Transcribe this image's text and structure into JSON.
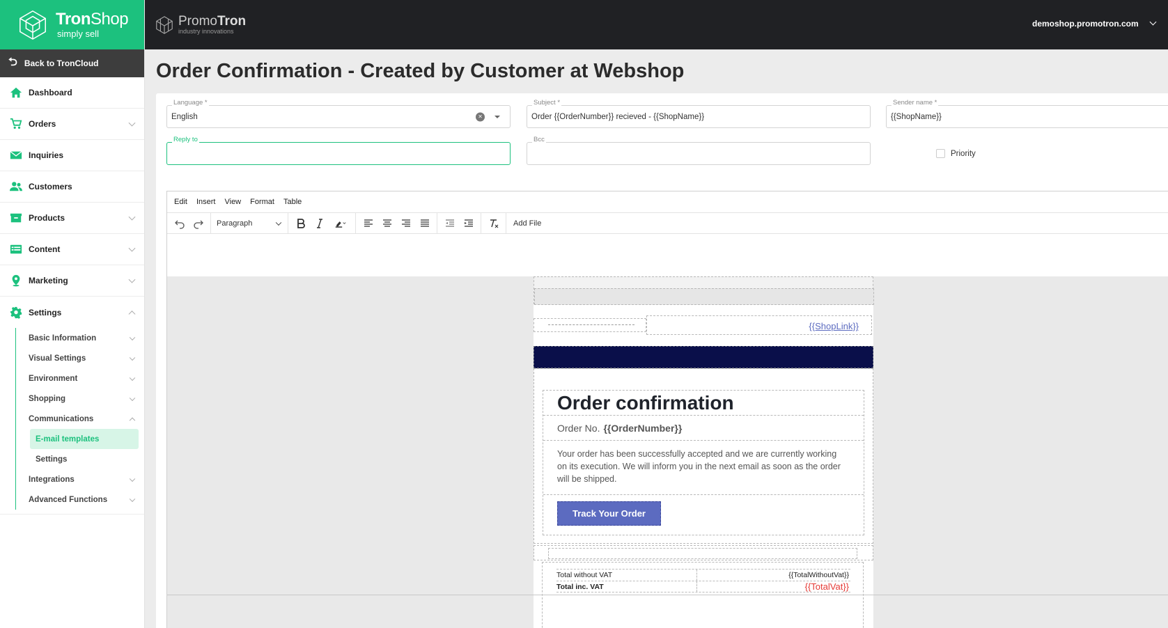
{
  "brand": {
    "name_bold": "Tron",
    "name_light": "Shop",
    "tagline": "simply sell",
    "logo_color": "#1cc17e"
  },
  "topbar": {
    "brand_light": "Promo",
    "brand_bold": "Tron",
    "brand_tagline": "industry innovations",
    "domain": "demoshop.promotron.com"
  },
  "sidebar": {
    "back": "Back to TronCloud",
    "items": [
      {
        "label": "Dashboard",
        "icon": "home-icon"
      },
      {
        "label": "Orders",
        "icon": "cart-icon"
      },
      {
        "label": "Inquiries",
        "icon": "envelope-icon"
      },
      {
        "label": "Customers",
        "icon": "users-icon"
      },
      {
        "label": "Products",
        "icon": "box-icon"
      },
      {
        "label": "Content",
        "icon": "list-icon"
      },
      {
        "label": "Marketing",
        "icon": "map-pin-icon"
      },
      {
        "label": "Settings",
        "icon": "gear-icon"
      }
    ],
    "settings_sub": [
      "Basic Information",
      "Visual Settings",
      "Environment",
      "Shopping",
      "Communications",
      "Integrations",
      "Advanced Functions"
    ],
    "communications_sub": [
      "E-mail templates",
      "Settings"
    ]
  },
  "page": {
    "title": "Order Confirmation - Created by Customer at Webshop"
  },
  "form": {
    "language": {
      "label": "Language *",
      "value": "English"
    },
    "subject": {
      "label": "Subject *",
      "value": "Order {{OrderNumber}} recieved - {{ShopName}}"
    },
    "sender": {
      "label": "Sender name *",
      "value": "{{ShopName}}"
    },
    "reply_to": {
      "label": "Reply to",
      "value": ""
    },
    "bcc": {
      "label": "Bcc",
      "value": ""
    },
    "priority": {
      "label": "Priority",
      "checked": false
    }
  },
  "editor": {
    "menu": [
      "Edit",
      "Insert",
      "View",
      "Format",
      "Table"
    ],
    "block_format": "Paragraph",
    "add_file": "Add File"
  },
  "email": {
    "shop_link": "{{ShopLink}}",
    "heading": "Order confirmation",
    "order_no_label": "Order No.",
    "order_no_value": "{{OrderNumber}}",
    "body": "Your order has been successfully accepted and we are currently working on its execution. We will inform you in the next email as soon as the order will be shipped.",
    "button": "Track Your Order",
    "button_color": "#5c6bc0",
    "header_band_color": "#0a0f4a",
    "totals": [
      {
        "label": "Total without VAT",
        "value": "{{TotalWithoutVat}}"
      },
      {
        "label": "Total inc. VAT",
        "value": "{{TotalVat}}"
      }
    ]
  }
}
